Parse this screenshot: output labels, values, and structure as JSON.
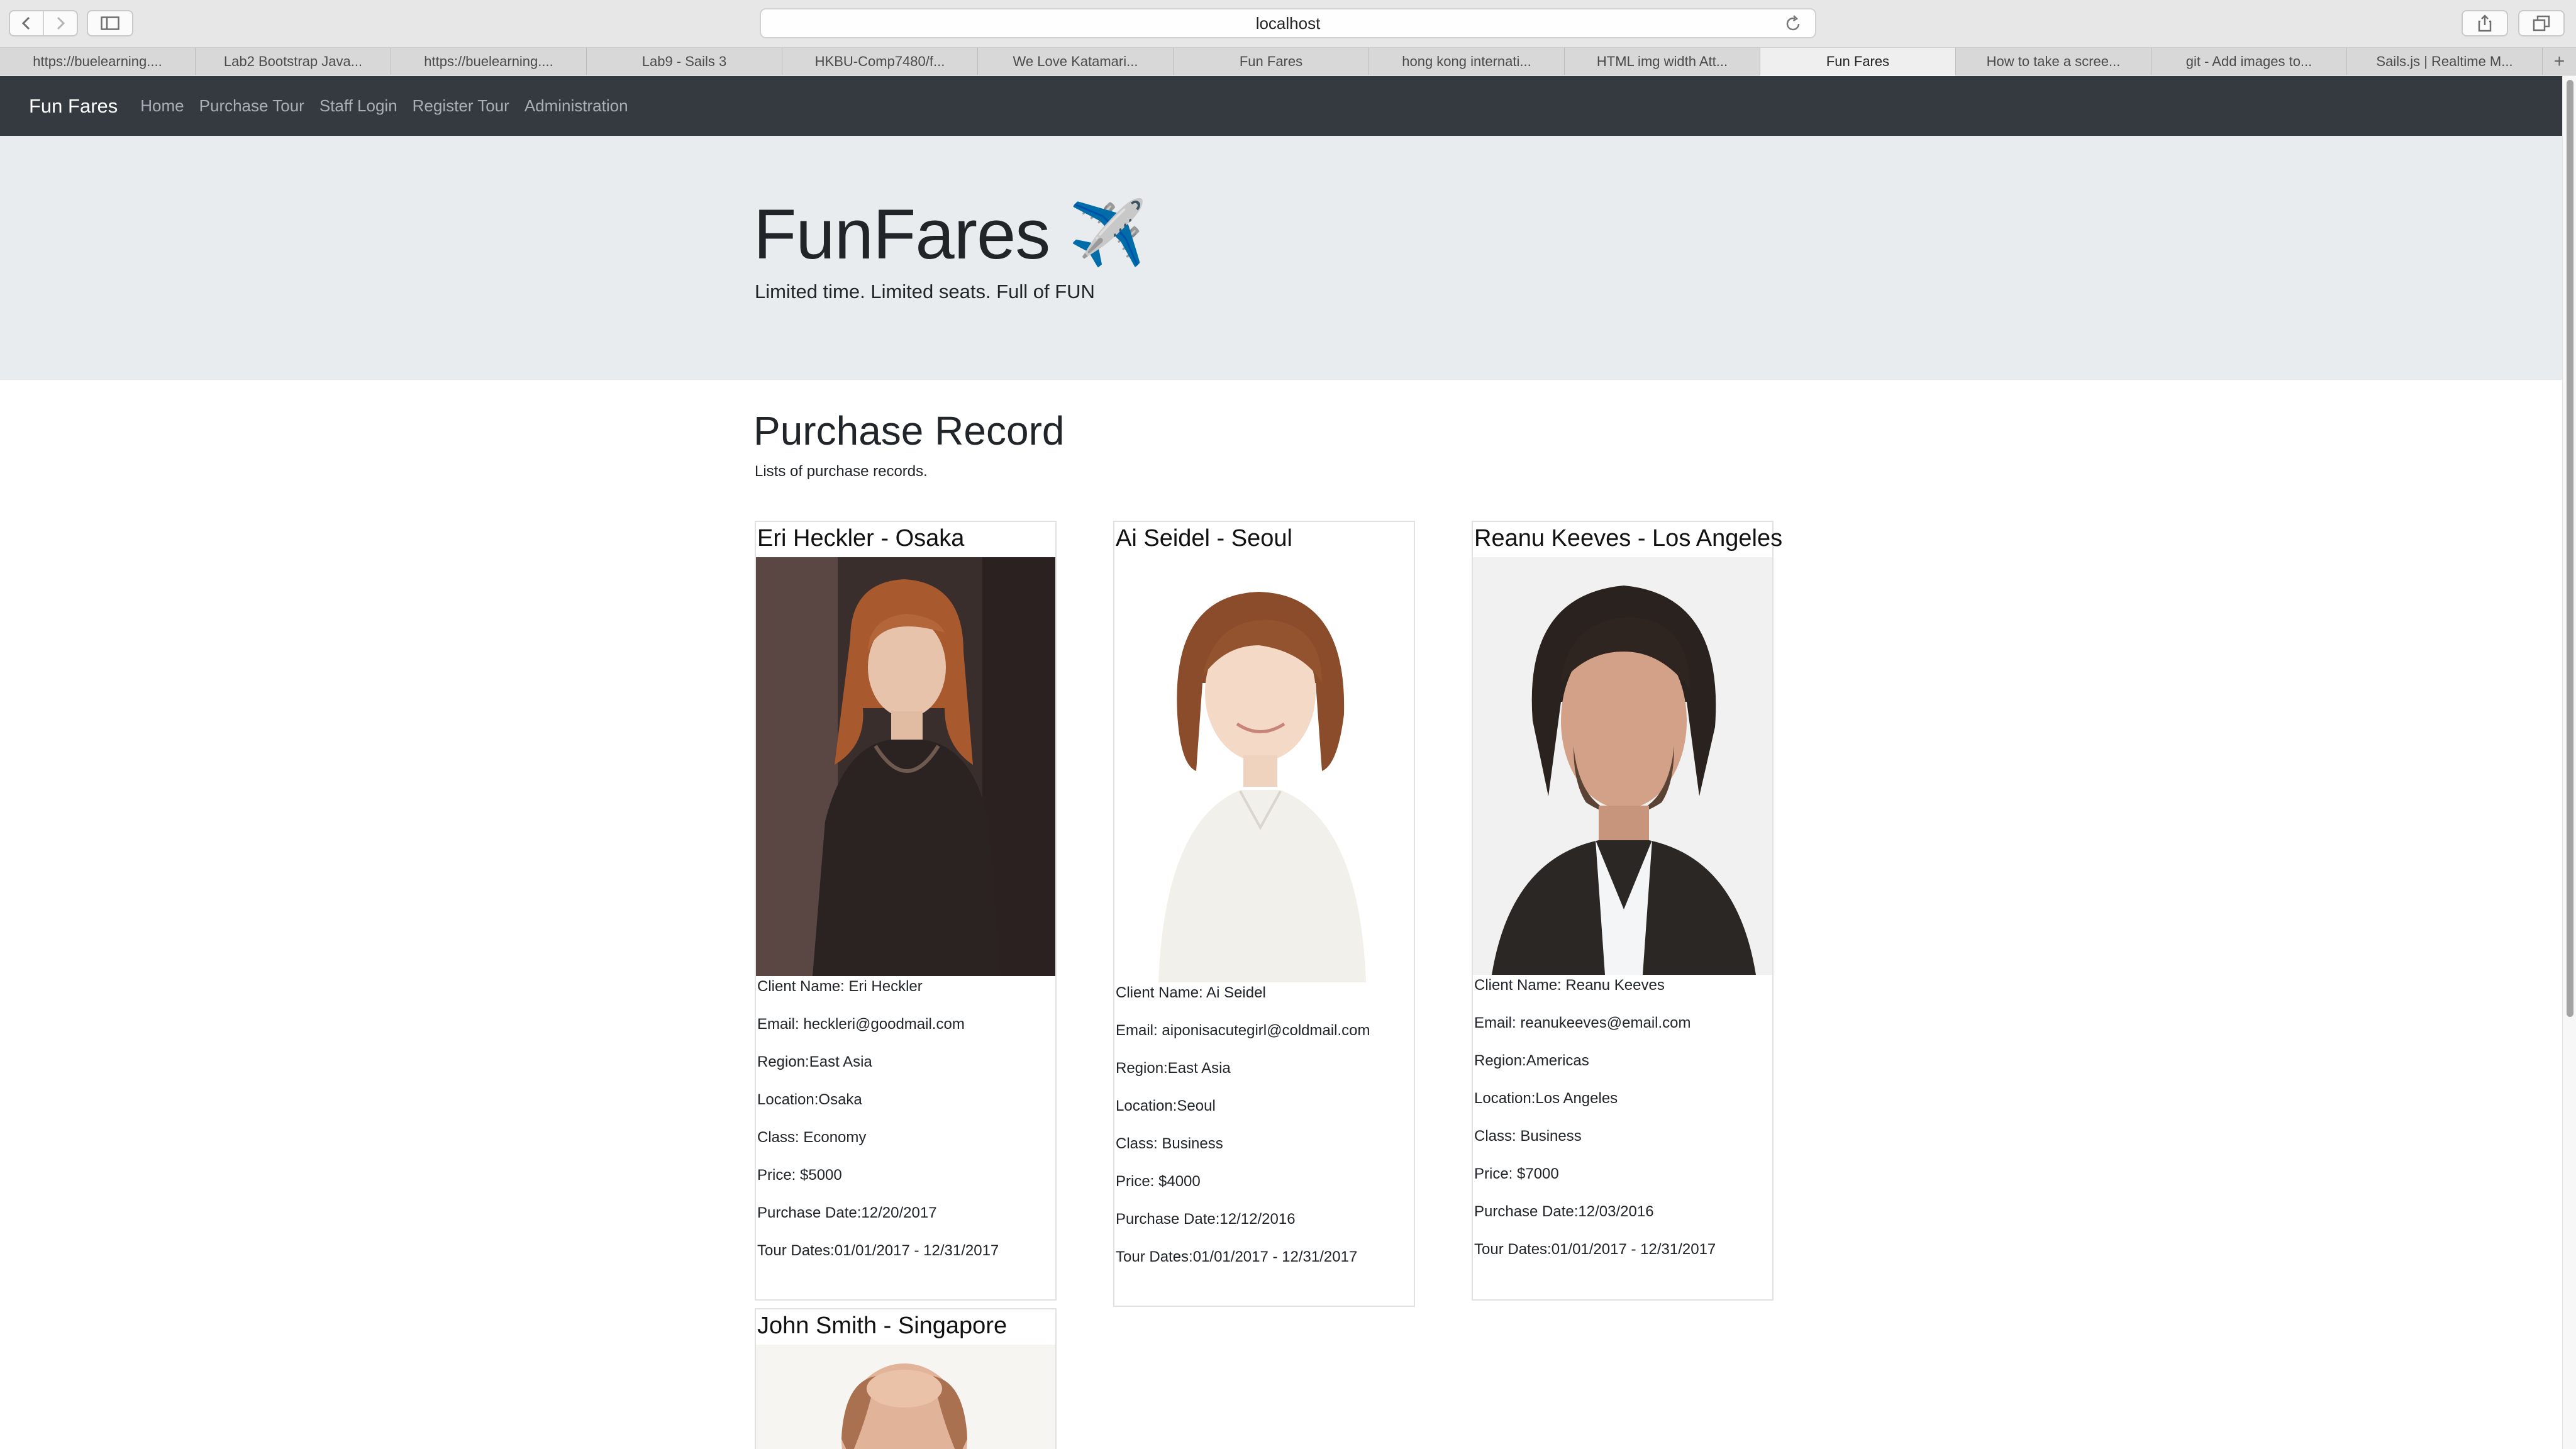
{
  "browser": {
    "address": "localhost",
    "tabs": [
      {
        "label": "https://buelearning....",
        "active": false
      },
      {
        "label": "Lab2 Bootstrap Java...",
        "active": false
      },
      {
        "label": "https://buelearning....",
        "active": false
      },
      {
        "label": "Lab9 - Sails 3",
        "active": false
      },
      {
        "label": "HKBU-Comp7480/f...",
        "active": false
      },
      {
        "label": "We Love Katamari...",
        "active": false
      },
      {
        "label": "Fun Fares",
        "active": false
      },
      {
        "label": "hong kong internati...",
        "active": false
      },
      {
        "label": "HTML img width Att...",
        "active": false
      },
      {
        "label": "Fun Fares",
        "active": true
      },
      {
        "label": "How to take a scree...",
        "active": false
      },
      {
        "label": "git - Add images to...",
        "active": false
      },
      {
        "label": "Sails.js | Realtime M...",
        "active": false
      }
    ],
    "new_tab": "+"
  },
  "navbar": {
    "brand": "Fun Fares",
    "links": [
      "Home",
      "Purchase Tour",
      "Staff Login",
      "Register Tour",
      "Administration"
    ]
  },
  "jumbotron": {
    "title": "FunFares",
    "emoji": "✈️",
    "tagline": "Limited time. Limited seats. Full of FUN"
  },
  "section": {
    "title": "Purchase Record",
    "subtitle": "Lists of purchase records."
  },
  "records": [
    {
      "heading": "Eri Heckler - Osaka",
      "client": "Client Name: Eri Heckler",
      "email": "Email: heckleri@goodmail.com",
      "region": "Region:East Asia",
      "location": "Location:Osaka",
      "class": "Class: Economy",
      "price": "Price: $5000",
      "purchase_date": "Purchase Date:12/20/2017",
      "tour_dates": "Tour Dates:01/01/2017 - 12/31/2017"
    },
    {
      "heading": "Ai Seidel - Seoul",
      "client": "Client Name: Ai Seidel",
      "email": "Email: aiponisacutegirl@coldmail.com",
      "region": "Region:East Asia",
      "location": "Location:Seoul",
      "class": "Class: Business",
      "price": "Price: $4000",
      "purchase_date": "Purchase Date:12/12/2016",
      "tour_dates": "Tour Dates:01/01/2017 - 12/31/2017"
    },
    {
      "heading": "Reanu Keeves - Los Angeles",
      "client": "Client Name: Reanu Keeves",
      "email": "Email: reanukeeves@email.com",
      "region": "Region:Americas",
      "location": "Location:Los Angeles",
      "class": "Class: Business",
      "price": "Price: $7000",
      "purchase_date": "Purchase Date:12/03/2016",
      "tour_dates": "Tour Dates:01/01/2017 - 12/31/2017"
    },
    {
      "heading": "John Smith - Singapore"
    }
  ]
}
